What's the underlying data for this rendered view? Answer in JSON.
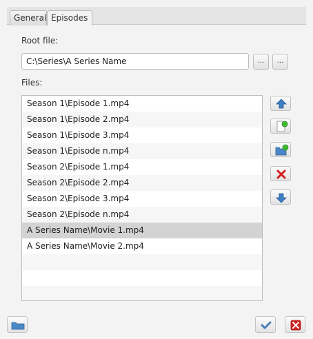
{
  "tabs": [
    "General",
    "Episodes"
  ],
  "root_file": {
    "label": "Root file:",
    "value": "C:\\Series\\A Series Name",
    "browse_file_label": "...",
    "browse_folder_label": "..."
  },
  "files": {
    "label": "Files:",
    "items": [
      "Season 1\\Episode 1.mp4",
      "Season 1\\Episode 2.mp4",
      "Season 1\\Episode 3.mp4",
      "Season 1\\Episode n.mp4",
      "Season 2\\Episode 1.mp4",
      "Season 2\\Episode 2.mp4",
      "Season 2\\Episode 3.mp4",
      "Season 2\\Episode n.mp4",
      "A Series Name\\Movie 1.mp4",
      "A Series Name\\Movie 2.mp4"
    ],
    "selected_index": 8
  },
  "side_buttons": [
    "arrow-up-icon",
    "add-file-icon",
    "add-folder-icon",
    "remove-icon",
    "arrow-down-icon"
  ],
  "footer_buttons": [
    "open-folder-icon",
    "confirm-icon",
    "cancel-icon"
  ],
  "colors": {
    "selection": "#d3d3d3",
    "accent_blue": "#3d7fc4",
    "delete_red": "#d32020",
    "add_green": "#3dbb2f"
  }
}
